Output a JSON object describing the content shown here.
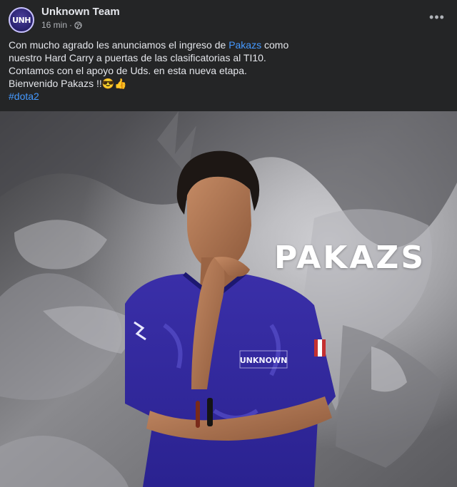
{
  "post": {
    "author": "Unknown Team",
    "avatar_text": "UNH",
    "time": "16 min",
    "separator": "·",
    "privacy_icon": "globe-icon",
    "more_icon": "more-options-icon",
    "more_label": "•••",
    "text": {
      "line1_before": "Con mucho agrado les anunciamos el ingreso de ",
      "mention": "Pakazs",
      "line1_after": " como",
      "line2": "nuestro Hard Carry a puertas de las clasificatorias al TI10.",
      "line3": "Contamos con el apoyo de Uds. en esta nueva etapa.",
      "line4": "Bienvenido Pakazs !!😎👍",
      "hashtag": "#dota2"
    }
  },
  "photo": {
    "overlay_name": "PAKAZS",
    "jersey_logo": "UNKNOWN"
  }
}
